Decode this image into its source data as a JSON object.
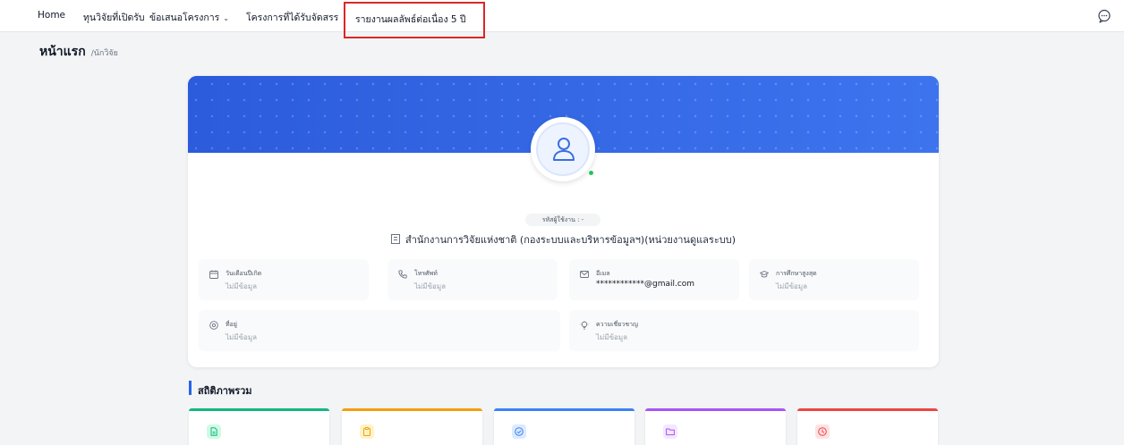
{
  "nav": {
    "items": [
      {
        "label": "Home"
      },
      {
        "label": "ทุนวิจัยที่เปิดรับ"
      },
      {
        "label": "ข้อเสนอโครงการ"
      },
      {
        "label": "โครงการที่ได้รับจัดสรร"
      },
      {
        "label": "รายงานผลลัพธ์ต่อเนื่อง 5 ปี"
      }
    ],
    "dropdown_glyph": "⌄"
  },
  "breadcrumb": {
    "title": "หน้าแรก",
    "sub": "/นักวิจัย"
  },
  "profile": {
    "user_id_label": "รหัสผู้ใช้งาน : -",
    "organization": "สำนักงานการวิจัยแห่งชาติ (กองระบบและบริหารข้อมูลฯ)(หน่วยงานดูแลระบบ)",
    "fields": [
      {
        "label": "วันเดือนปีเกิด",
        "value": "ไม่มีข้อมูล"
      },
      {
        "label": "โทรศัพท์",
        "value": "ไม่มีข้อมูล"
      },
      {
        "label": "อีเมล",
        "value": "************@gmail.com"
      },
      {
        "label": "การศึกษาสูงสุด",
        "value": "ไม่มีข้อมูล"
      },
      {
        "label": "ที่อยู่",
        "value": "ไม่มีข้อมูล"
      },
      {
        "label": "ความเชี่ยวชาญ",
        "value": "ไม่มีข้อมูล"
      }
    ]
  },
  "stats": {
    "title": "สถิติภาพรวม"
  },
  "colors": {
    "accent": "#2563eb",
    "highlight_border": "#dc2626",
    "online": "#22c55e",
    "stat_green": "#10b981",
    "stat_orange": "#f59e0b",
    "stat_blue": "#3b82f6",
    "stat_purple": "#a855f7",
    "stat_red": "#ef4444"
  }
}
